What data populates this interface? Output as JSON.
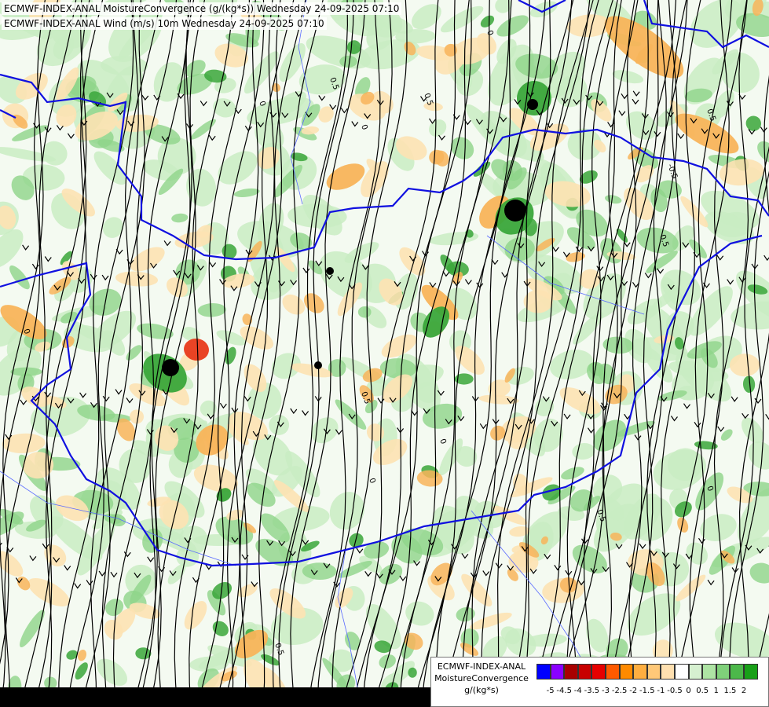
{
  "titles": {
    "line1": "ECMWF-INDEX-ANAL MoistureConvergence (g/(kg*s)) Wednesday 24-09-2025 07:10",
    "line2": "ECMWF-INDEX-ANAL Wind (m/s) 10m Wednesday 24-09-2025 07:10"
  },
  "legend": {
    "source": "ECMWF-INDEX-ANAL",
    "parameter": "MoistureConvergence",
    "unit": "g/(kg*s)",
    "colors": [
      "#0000ff",
      "#8a00ff",
      "#a80000",
      "#c80000",
      "#e60000",
      "#ff5a00",
      "#ff8a00",
      "#ffae40",
      "#ffc878",
      "#ffe0b0",
      "#ffffff",
      "#d6f0d0",
      "#aee4a4",
      "#7fd07a",
      "#4cb84a",
      "#18a018"
    ],
    "tick_labels": [
      "-5",
      "-4.5",
      "-4",
      "-3.5",
      "-3",
      "-2.5",
      "-2",
      "-1.5",
      "-1",
      "-0.5",
      "0",
      "0.5",
      "1",
      "1.5",
      "2"
    ]
  },
  "contour_labels": [
    "0",
    "0.5",
    "0",
    "0.5",
    "0",
    "-0.5",
    "0.5",
    "0",
    "0.5",
    "0",
    "0.5",
    "0",
    "0.5",
    "0",
    "0.5"
  ],
  "colors": {
    "border": "#1010e0",
    "river": "#5a6aff",
    "streamline": "#000000",
    "green_light": "#c9ecc3",
    "green_mid": "#8fd48a",
    "green_dark": "#3aa63a",
    "orange_light": "#fde2b3",
    "orange_mid": "#f8b45a",
    "red": "#e83a1a"
  }
}
